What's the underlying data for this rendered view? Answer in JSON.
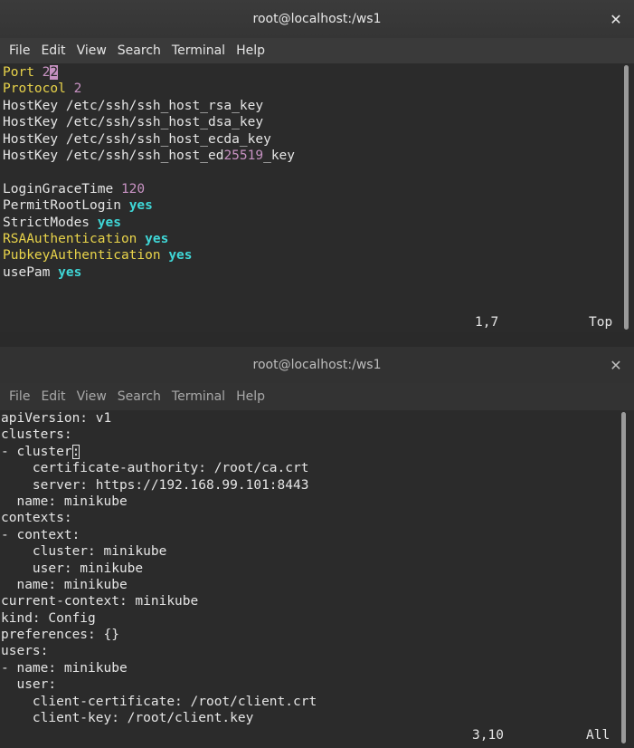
{
  "windows": [
    {
      "title": "root@localhost:/ws1",
      "menu": [
        "File",
        "Edit",
        "View",
        "Search",
        "Terminal",
        "Help"
      ],
      "lines": [
        [
          {
            "t": "Port ",
            "c": "yel"
          },
          {
            "t": "2",
            "c": "pur"
          },
          {
            "t": "2",
            "c": "cursor"
          }
        ],
        [
          {
            "t": "Protocol ",
            "c": "yel"
          },
          {
            "t": "2",
            "c": "pur"
          }
        ],
        [
          {
            "t": "HostKey /etc/ssh/ssh_host_rsa_key"
          }
        ],
        [
          {
            "t": "HostKey /etc/ssh/ssh_host_dsa_key"
          }
        ],
        [
          {
            "t": "HostKey /etc/ssh/ssh_host_ecda_key"
          }
        ],
        [
          {
            "t": "HostKey /etc/ssh/ssh_host_ed"
          },
          {
            "t": "25519",
            "c": "pur"
          },
          {
            "t": "_key"
          }
        ],
        [
          {
            "t": ""
          }
        ],
        [
          {
            "t": "LoginGraceTime "
          },
          {
            "t": "120",
            "c": "pur"
          }
        ],
        [
          {
            "t": "PermitRootLogin "
          },
          {
            "t": "yes",
            "c": "cyan"
          }
        ],
        [
          {
            "t": "StrictModes "
          },
          {
            "t": "yes",
            "c": "cyan"
          }
        ],
        [
          {
            "t": "RSAAuthentication ",
            "c": "yel"
          },
          {
            "t": "yes",
            "c": "cyan"
          }
        ],
        [
          {
            "t": "PubkeyAuthentication ",
            "c": "yel"
          },
          {
            "t": "yes",
            "c": "cyan"
          }
        ],
        [
          {
            "t": "usePam "
          },
          {
            "t": "yes",
            "c": "cyan"
          }
        ]
      ],
      "position": "1,7",
      "scroll": "Top"
    },
    {
      "title": "root@localhost:/ws1",
      "menu": [
        "File",
        "Edit",
        "View",
        "Search",
        "Terminal",
        "Help"
      ],
      "lines": [
        [
          {
            "t": "apiVersion: v1"
          }
        ],
        [
          {
            "t": "clusters:"
          }
        ],
        [
          {
            "t": "- cluster"
          },
          {
            "t": ":",
            "c": "cursor2"
          }
        ],
        [
          {
            "t": "    certificate-authority: /root/ca.crt"
          }
        ],
        [
          {
            "t": "    server: https://192.168.99.101:8443"
          }
        ],
        [
          {
            "t": "  name: minikube"
          }
        ],
        [
          {
            "t": "contexts:"
          }
        ],
        [
          {
            "t": "- context:"
          }
        ],
        [
          {
            "t": "    cluster: minikube"
          }
        ],
        [
          {
            "t": "    user: minikube"
          }
        ],
        [
          {
            "t": "  name: minikube"
          }
        ],
        [
          {
            "t": "current-context: minikube"
          }
        ],
        [
          {
            "t": "kind: Config"
          }
        ],
        [
          {
            "t": "preferences: {}"
          }
        ],
        [
          {
            "t": "users:"
          }
        ],
        [
          {
            "t": "- name: minikube"
          }
        ],
        [
          {
            "t": "  user:"
          }
        ],
        [
          {
            "t": "    client-certificate: /root/client.crt"
          }
        ],
        [
          {
            "t": "    client-key: /root/client.key"
          }
        ]
      ],
      "position": "3,10",
      "scroll": "All"
    }
  ],
  "icons": {
    "close": "close-icon"
  }
}
